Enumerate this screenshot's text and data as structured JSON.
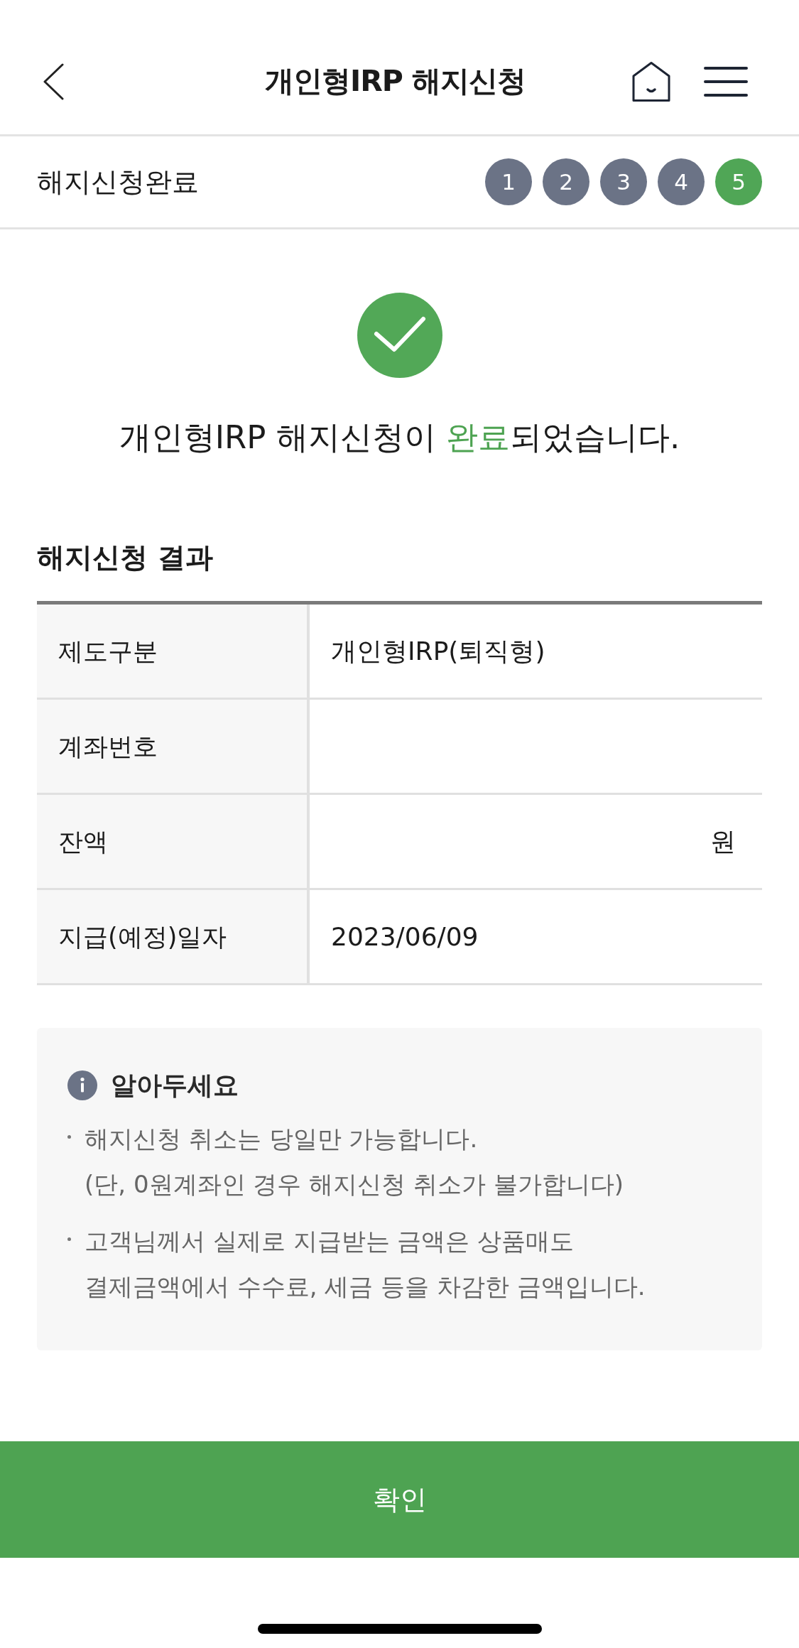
{
  "header": {
    "title": "개인형IRP 해지신청"
  },
  "progress": {
    "label": "해지신청완료",
    "steps": [
      {
        "label": "1",
        "selected": false
      },
      {
        "label": "2",
        "selected": false
      },
      {
        "label": "3",
        "selected": false
      },
      {
        "label": "4",
        "selected": false
      },
      {
        "label": "5",
        "selected": true
      }
    ]
  },
  "result": {
    "message": {
      "before": "개인형IRP 해지신청이 ",
      "highlight": "완료",
      "after": "되었습니다."
    },
    "section_title": "해지신청 결과",
    "rows": [
      {
        "label": "제도구분",
        "value": "개인형IRP(퇴직형)"
      },
      {
        "label": "계좌번호"
      },
      {
        "label": "잔액",
        "unit": "원"
      },
      {
        "label": "지급(예정)일자",
        "value": "2023/06/09"
      }
    ]
  },
  "notice": {
    "title": "알아두세요",
    "items": [
      "해지신청 취소는 당일만 가능합니다.\n(단, 0원계좌인 경우 해지신청 취소가 불가합니다)",
      "고객님께서 실제로 지급받는 금액은 상품매도\n결제금액에서 수수료, 세금 등을 차감한 금액입니다."
    ]
  },
  "confirm_button": "확인"
}
